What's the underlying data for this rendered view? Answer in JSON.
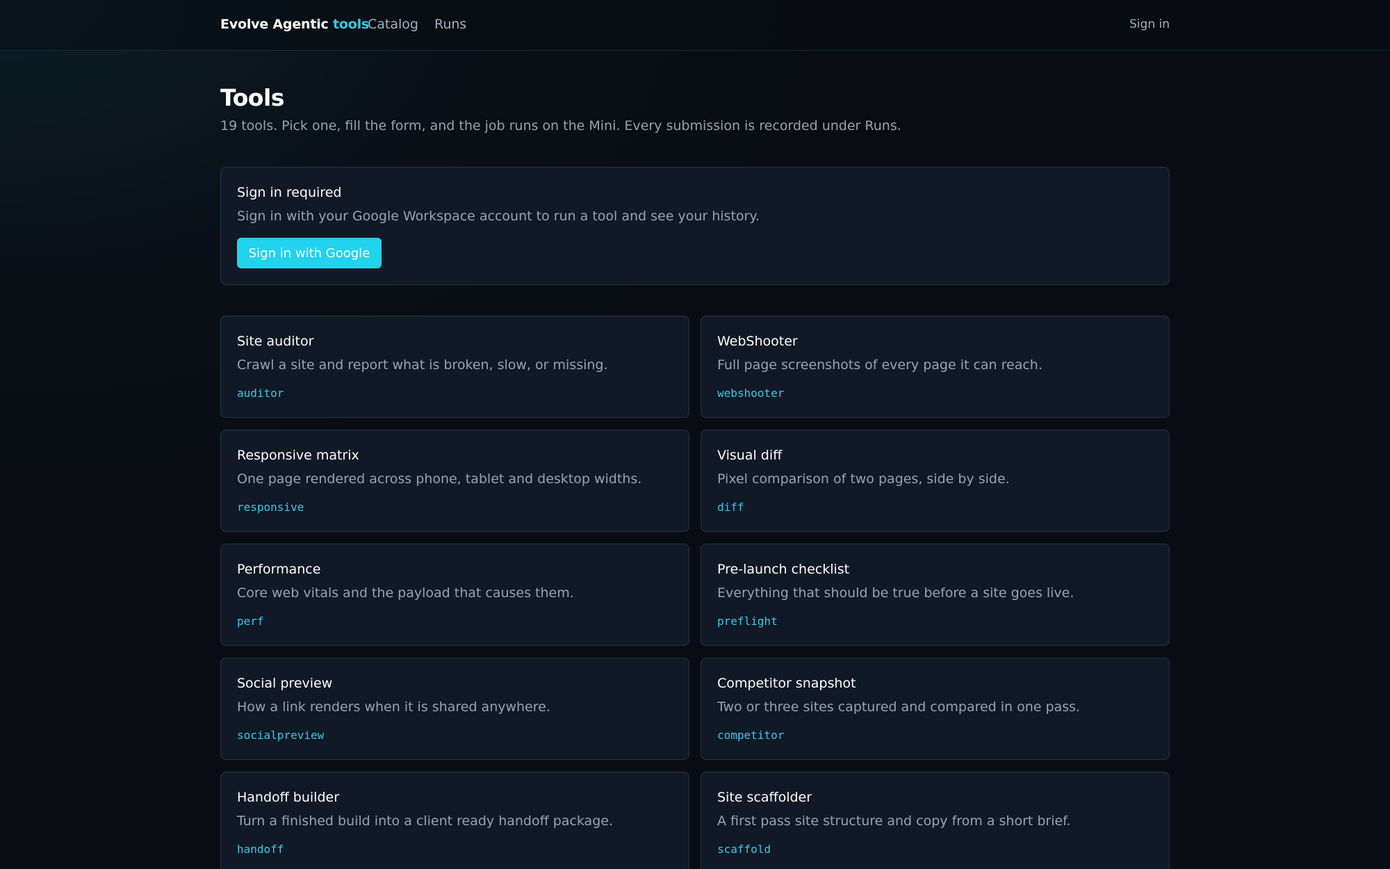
{
  "header": {
    "brand_main": "Evolve Agentic",
    "brand_accent": "tools",
    "nav": [
      {
        "label": "Catalog"
      },
      {
        "label": "Runs"
      }
    ],
    "sign_in_label": "Sign in"
  },
  "page": {
    "title": "Tools",
    "subtitle": "19 tools. Pick one, fill the form, and the job runs on the Mini. Every submission is recorded under Runs."
  },
  "signin_notice": {
    "title": "Sign in required",
    "description": "Sign in with your Google Workspace account to run a tool and see your history.",
    "button_label": "Sign in with Google"
  },
  "tools": [
    {
      "name": "Site auditor",
      "description": "Crawl a site and report what is broken, slow, or missing.",
      "slug": "auditor"
    },
    {
      "name": "WebShooter",
      "description": "Full page screenshots of every page it can reach.",
      "slug": "webshooter"
    },
    {
      "name": "Responsive matrix",
      "description": "One page rendered across phone, tablet and desktop widths.",
      "slug": "responsive"
    },
    {
      "name": "Visual diff",
      "description": "Pixel comparison of two pages, side by side.",
      "slug": "diff"
    },
    {
      "name": "Performance",
      "description": "Core web vitals and the payload that causes them.",
      "slug": "perf"
    },
    {
      "name": "Pre-launch checklist",
      "description": "Everything that should be true before a site goes live.",
      "slug": "preflight"
    },
    {
      "name": "Social preview",
      "description": "How a link renders when it is shared anywhere.",
      "slug": "socialpreview"
    },
    {
      "name": "Competitor snapshot",
      "description": "Two or three sites captured and compared in one pass.",
      "slug": "competitor"
    },
    {
      "name": "Handoff builder",
      "description": "Turn a finished build into a client ready handoff package.",
      "slug": "handoff"
    },
    {
      "name": "Site scaffolder",
      "description": "A first pass site structure and copy from a short brief.",
      "slug": "scaffold"
    }
  ],
  "colors": {
    "accent": "#22d3ee",
    "card_background": "#111926",
    "page_background": "#0a0e14"
  }
}
